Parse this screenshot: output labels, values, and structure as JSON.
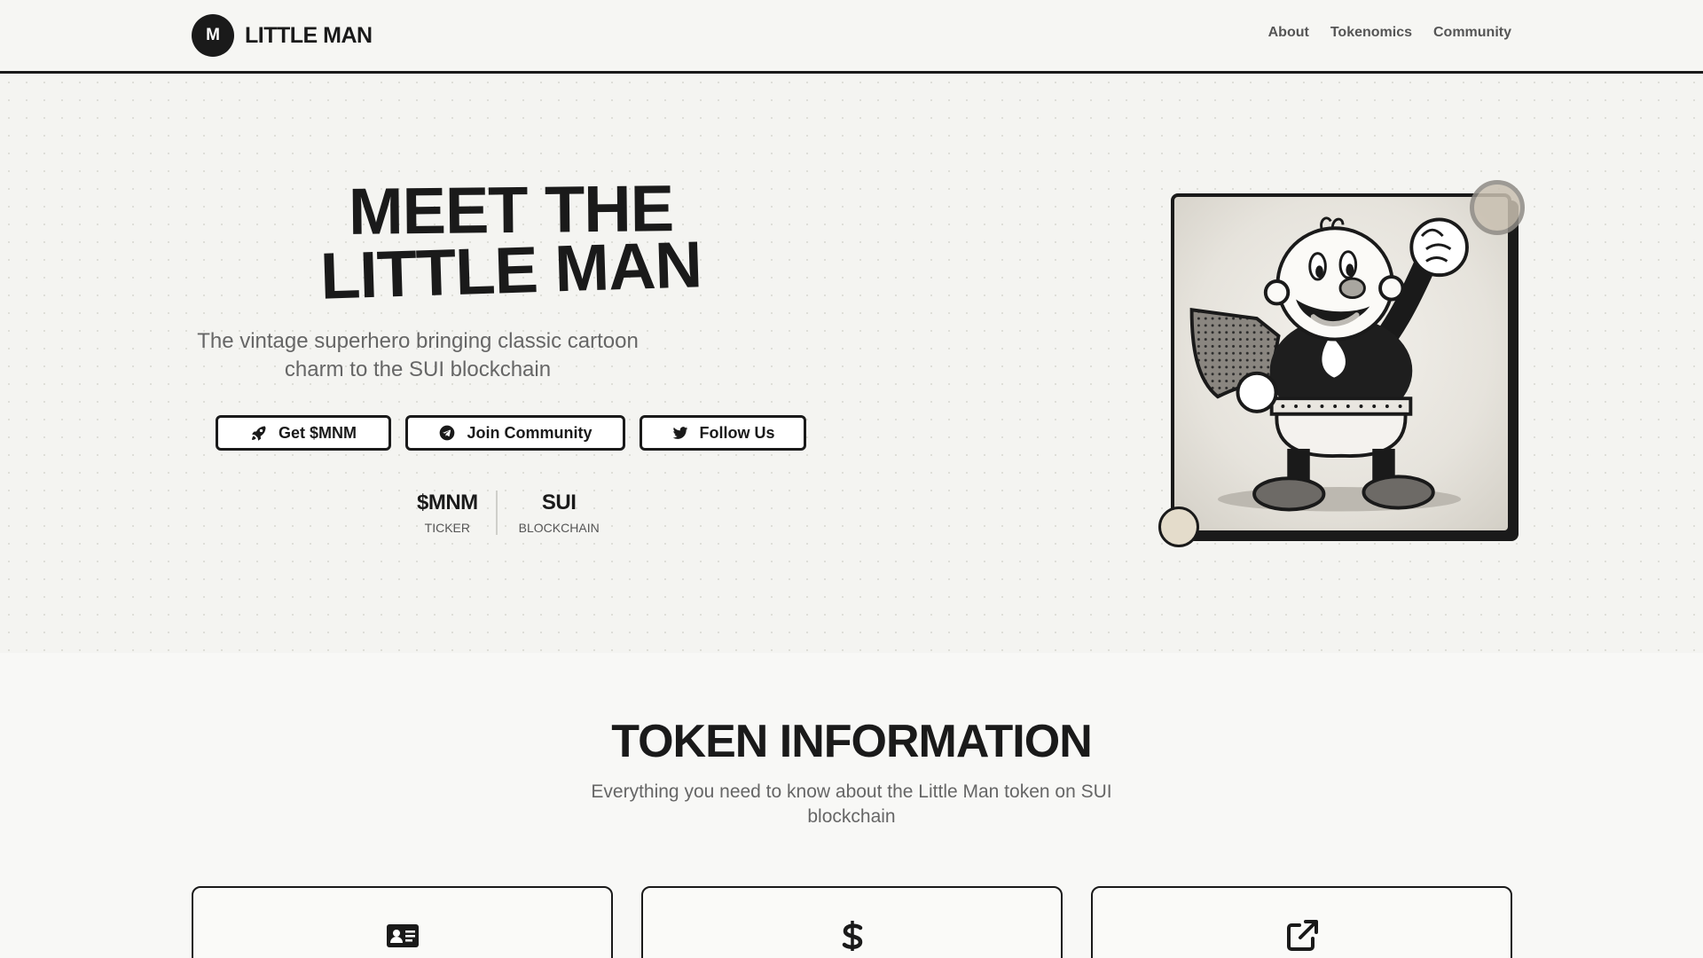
{
  "brand": {
    "mark": "M",
    "name": "LITTLE MAN"
  },
  "nav": {
    "items": [
      "About",
      "Tokenomics",
      "Community"
    ]
  },
  "hero": {
    "title_line1": "MEET THE",
    "title_line2": "LITTLE MAN",
    "subtitle": "The vintage superhero bringing classic cartoon charm to the SUI blockchain",
    "buttons": [
      {
        "label": "Get $MNM",
        "icon": "rocket-icon"
      },
      {
        "label": "Join Community",
        "icon": "telegram-icon"
      },
      {
        "label": "Follow Us",
        "icon": "twitter-icon"
      }
    ],
    "stats": [
      {
        "value": "$MNM",
        "label": "TICKER"
      },
      {
        "value": "SUI",
        "label": "BLOCKCHAIN"
      }
    ],
    "image_alt": "Little Man cartoon mascot"
  },
  "token_section": {
    "title": "TOKEN INFORMATION",
    "subtitle": "Everything you need to know about the Little Man token on SUI blockchain",
    "cards": [
      {
        "icon": "id-card-icon"
      },
      {
        "icon": "dollar-icon"
      },
      {
        "icon": "external-link-icon"
      }
    ]
  }
}
